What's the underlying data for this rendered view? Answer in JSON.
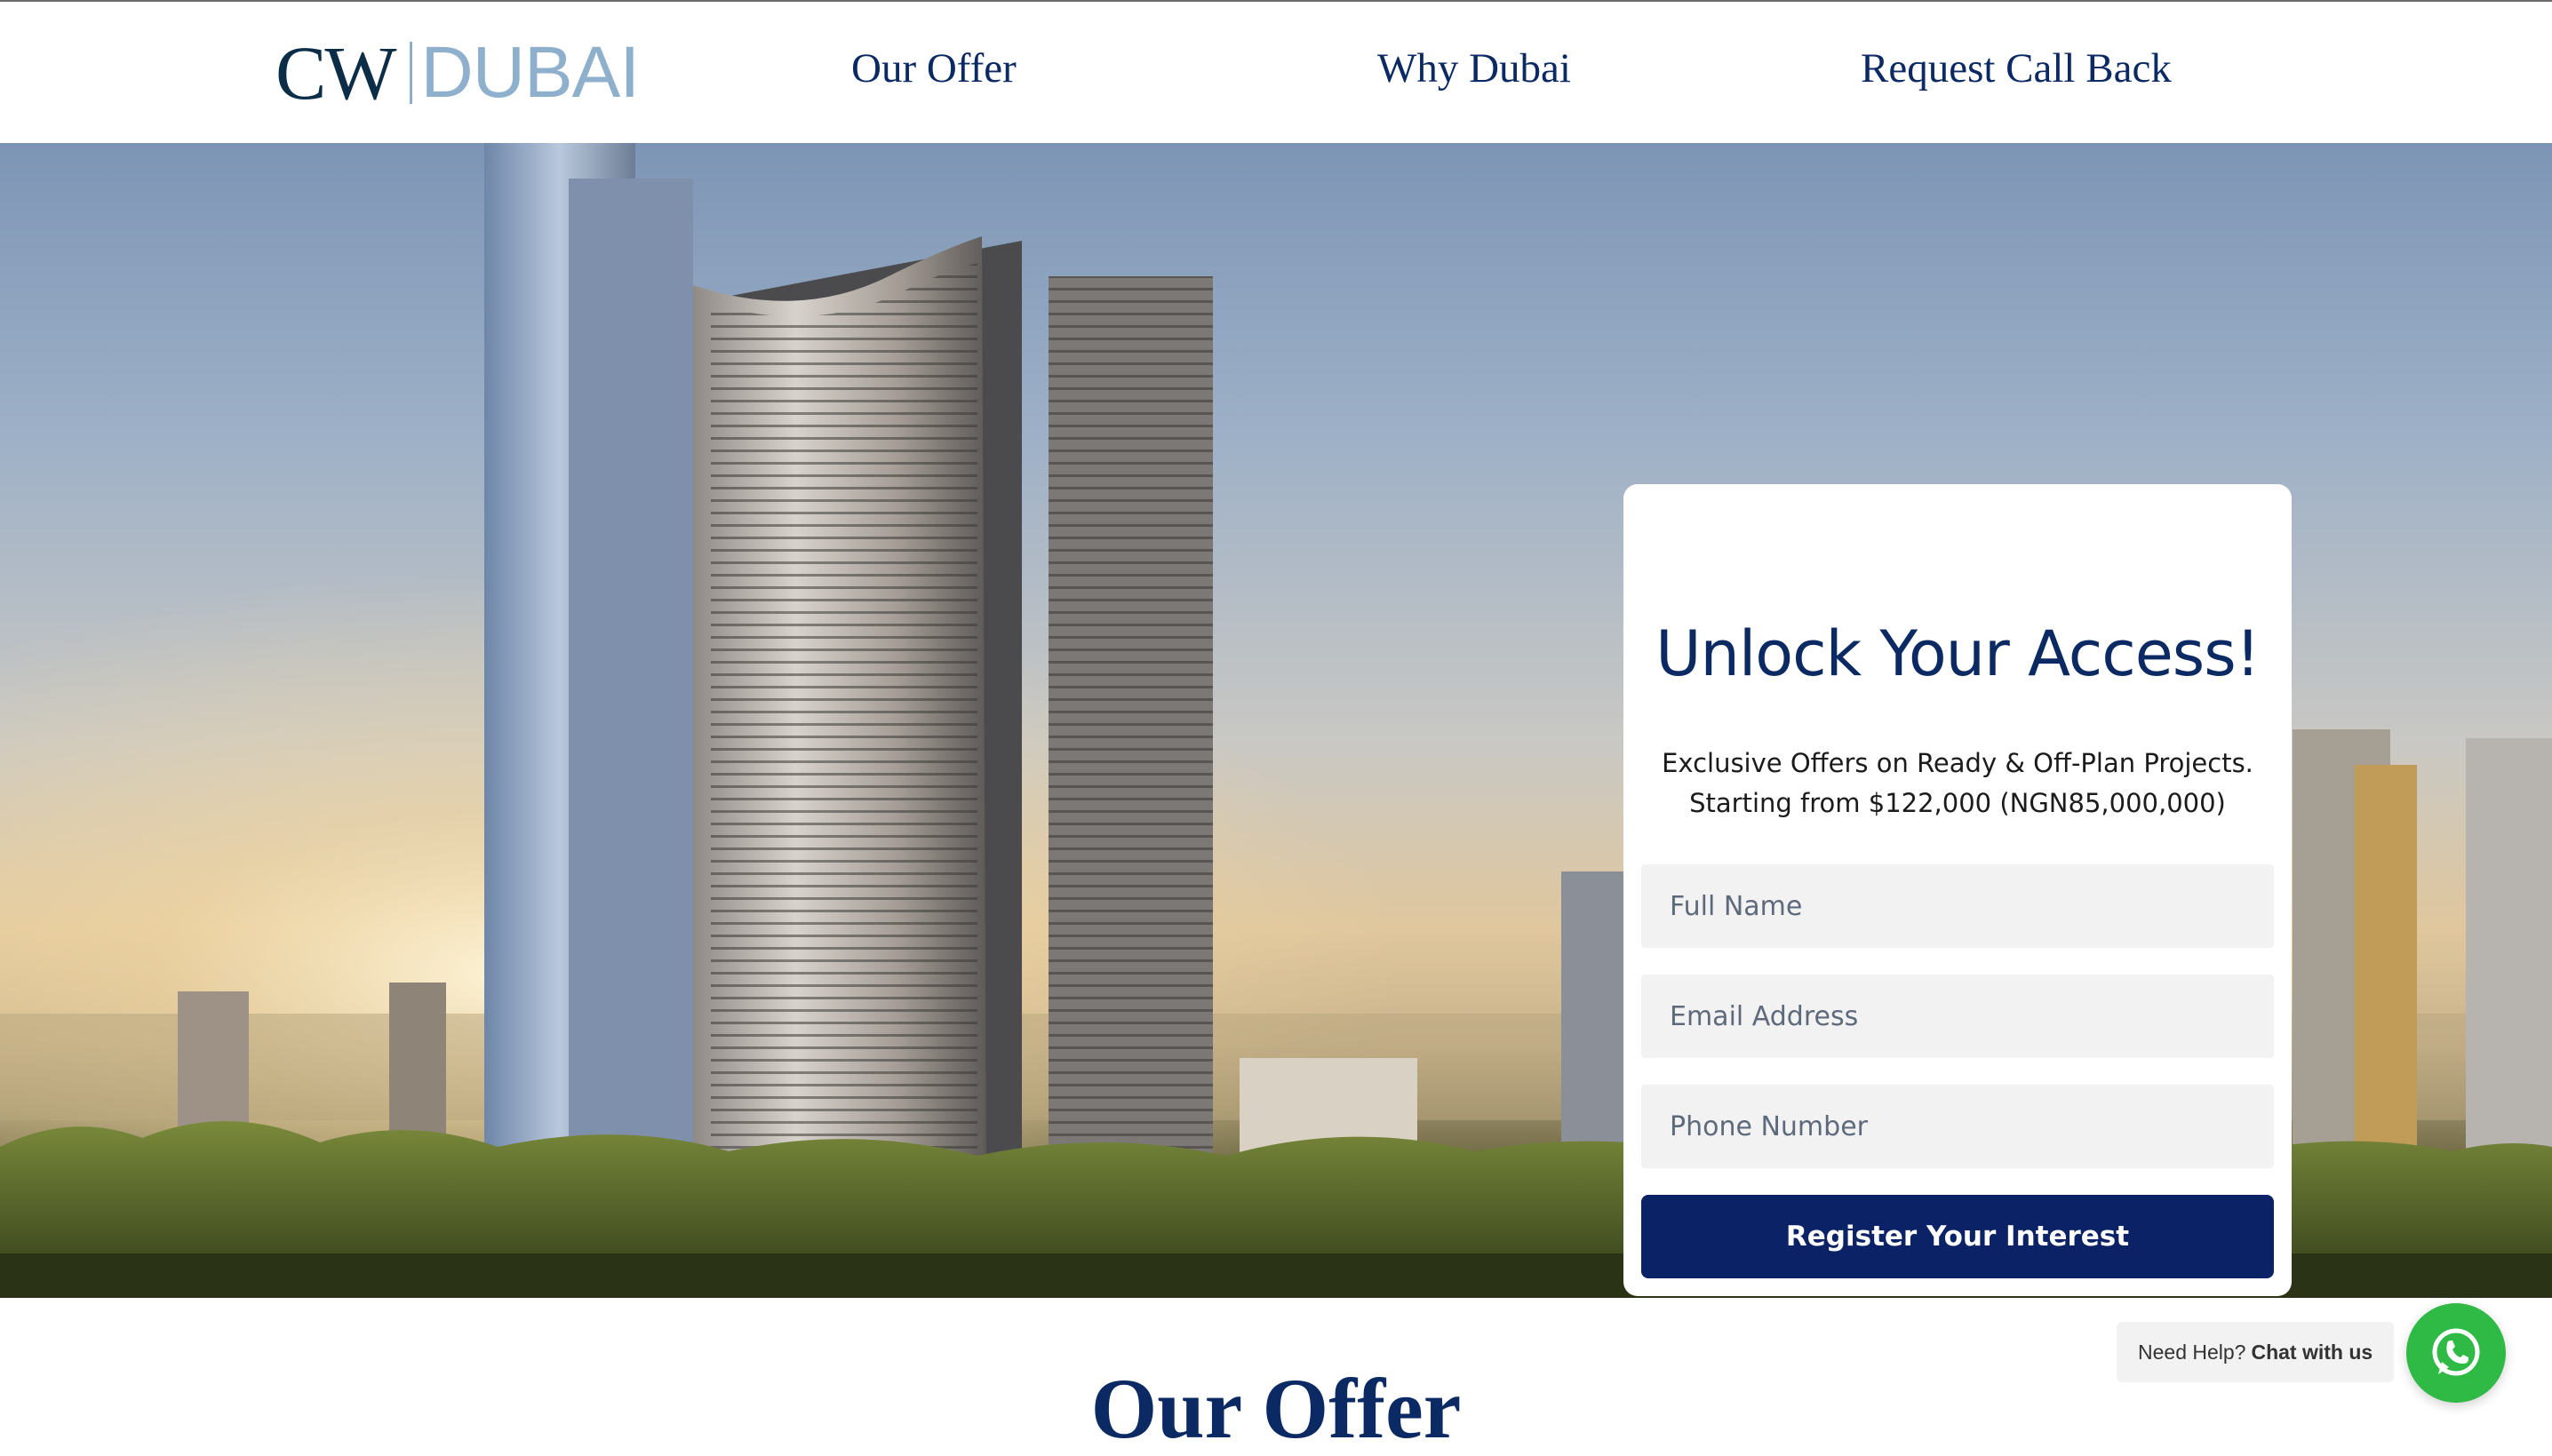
{
  "header": {
    "logo": {
      "primary": "CW",
      "secondary": "DUBAI"
    },
    "nav": [
      {
        "label": "Our Offer"
      },
      {
        "label": "Why Dubai"
      },
      {
        "label": "Request Call Back"
      }
    ]
  },
  "hero": {
    "background_icon": "dubai-skyline-illustration",
    "form": {
      "title": "Unlock Your Access!",
      "subtitle_line1": "Exclusive Offers on Ready & Off-Plan Projects.",
      "subtitle_line2": "Starting from $122,000 (NGN85,000,000)",
      "fields": {
        "full_name": {
          "placeholder": "Full Name",
          "value": ""
        },
        "email": {
          "placeholder": "Email Address",
          "value": ""
        },
        "phone": {
          "placeholder": "Phone Number",
          "value": ""
        }
      },
      "submit_label": "Register Your Interest"
    }
  },
  "offer_section": {
    "title": "Our Offer"
  },
  "chat": {
    "prefix": "Need Help?",
    "action": "Chat with us",
    "icon": "whatsapp-icon"
  },
  "colors": {
    "brand_navy": "#0b2a63",
    "button_navy": "#0b2266",
    "whatsapp_green": "#2fb945",
    "logo_light": "#8fb0cc"
  }
}
